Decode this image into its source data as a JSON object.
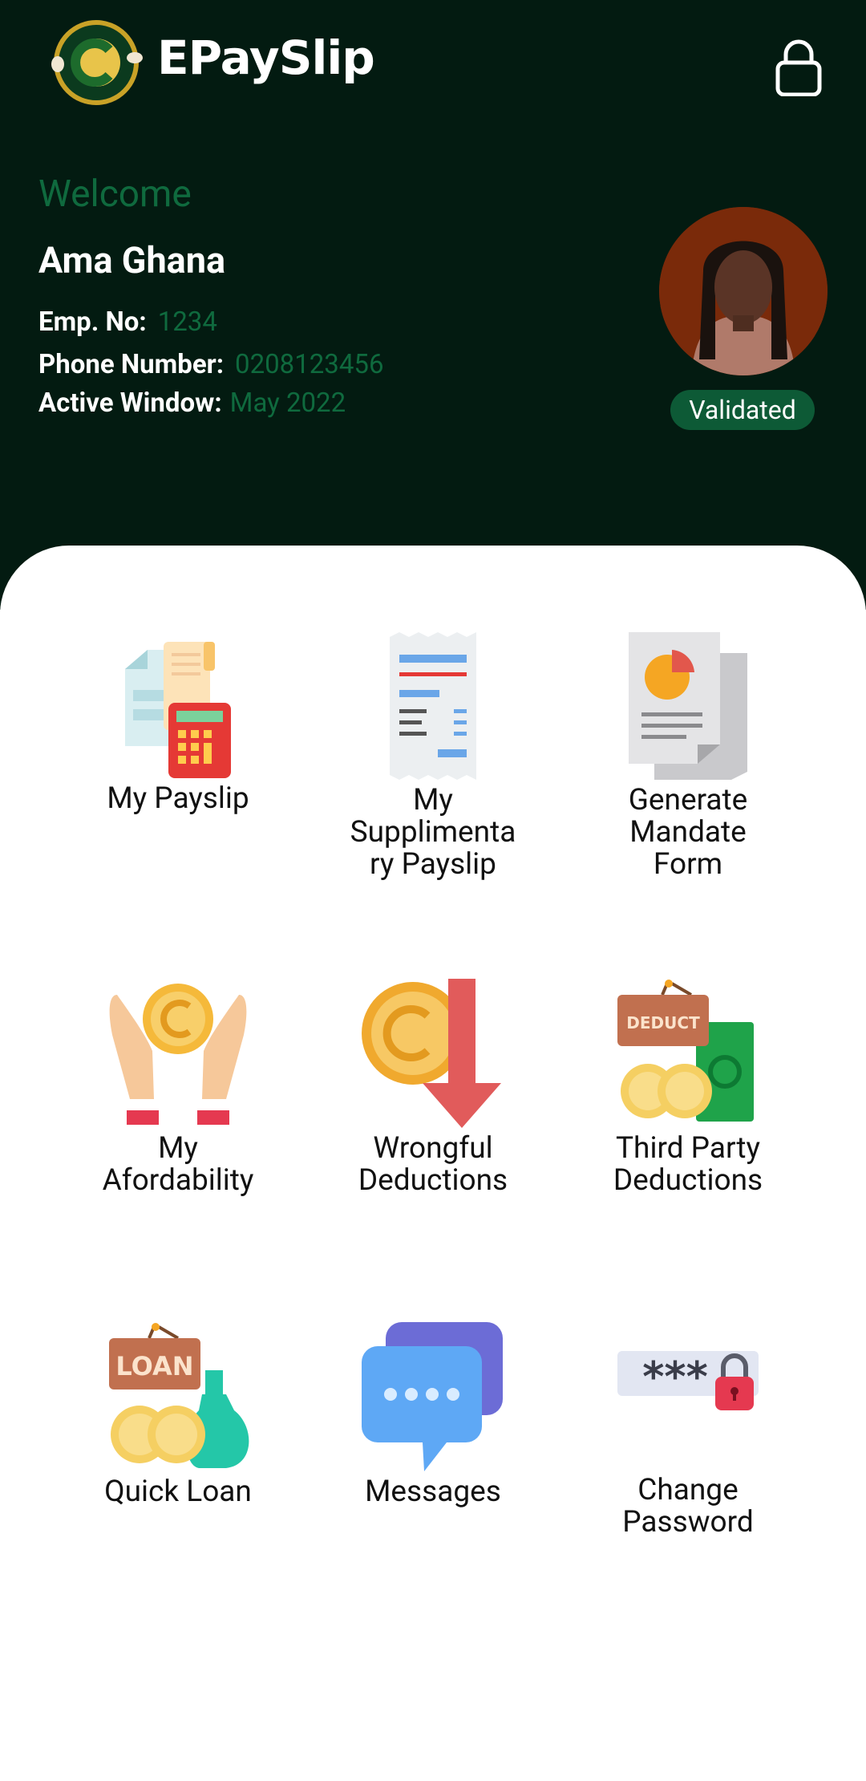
{
  "header": {
    "brand": "EPaySlip",
    "welcome": "Welcome",
    "user_name": "Ama Ghana",
    "emp_no_label": "Emp. No:",
    "emp_no_value": "1234",
    "phone_label": "Phone Number:",
    "phone_value": "0208123456",
    "window_label": "Active Window:",
    "window_value": "May 2022",
    "status_badge": "Validated",
    "logo_icon": "controller-accountant-generals-department-logo",
    "lock_icon": "lock-icon"
  },
  "menu": [
    {
      "label": "My Payslip",
      "icon": "payslip-calculator-icon"
    },
    {
      "label": "My\nSupplimenta\nry Payslip",
      "icon": "receipt-icon"
    },
    {
      "label": "Generate\nMandate\nForm",
      "icon": "report-document-icon"
    },
    {
      "label": "My\nAfordability",
      "icon": "hands-coin-icon"
    },
    {
      "label": "Wrongful\nDeductions",
      "icon": "coin-down-arrow-icon"
    },
    {
      "label": "Third Party\nDeductions",
      "icon": "deduct-sign-money-icon"
    },
    {
      "label": "Quick Loan",
      "icon": "loan-sign-money-bag-icon"
    },
    {
      "label": "Messages",
      "icon": "chat-bubbles-icon"
    },
    {
      "label": "Change\nPassword",
      "icon": "password-lock-icon"
    }
  ],
  "colors": {
    "header_bg": "#031b11",
    "accent_green": "#0f6a3e",
    "badge_bg": "#0d5a36"
  }
}
